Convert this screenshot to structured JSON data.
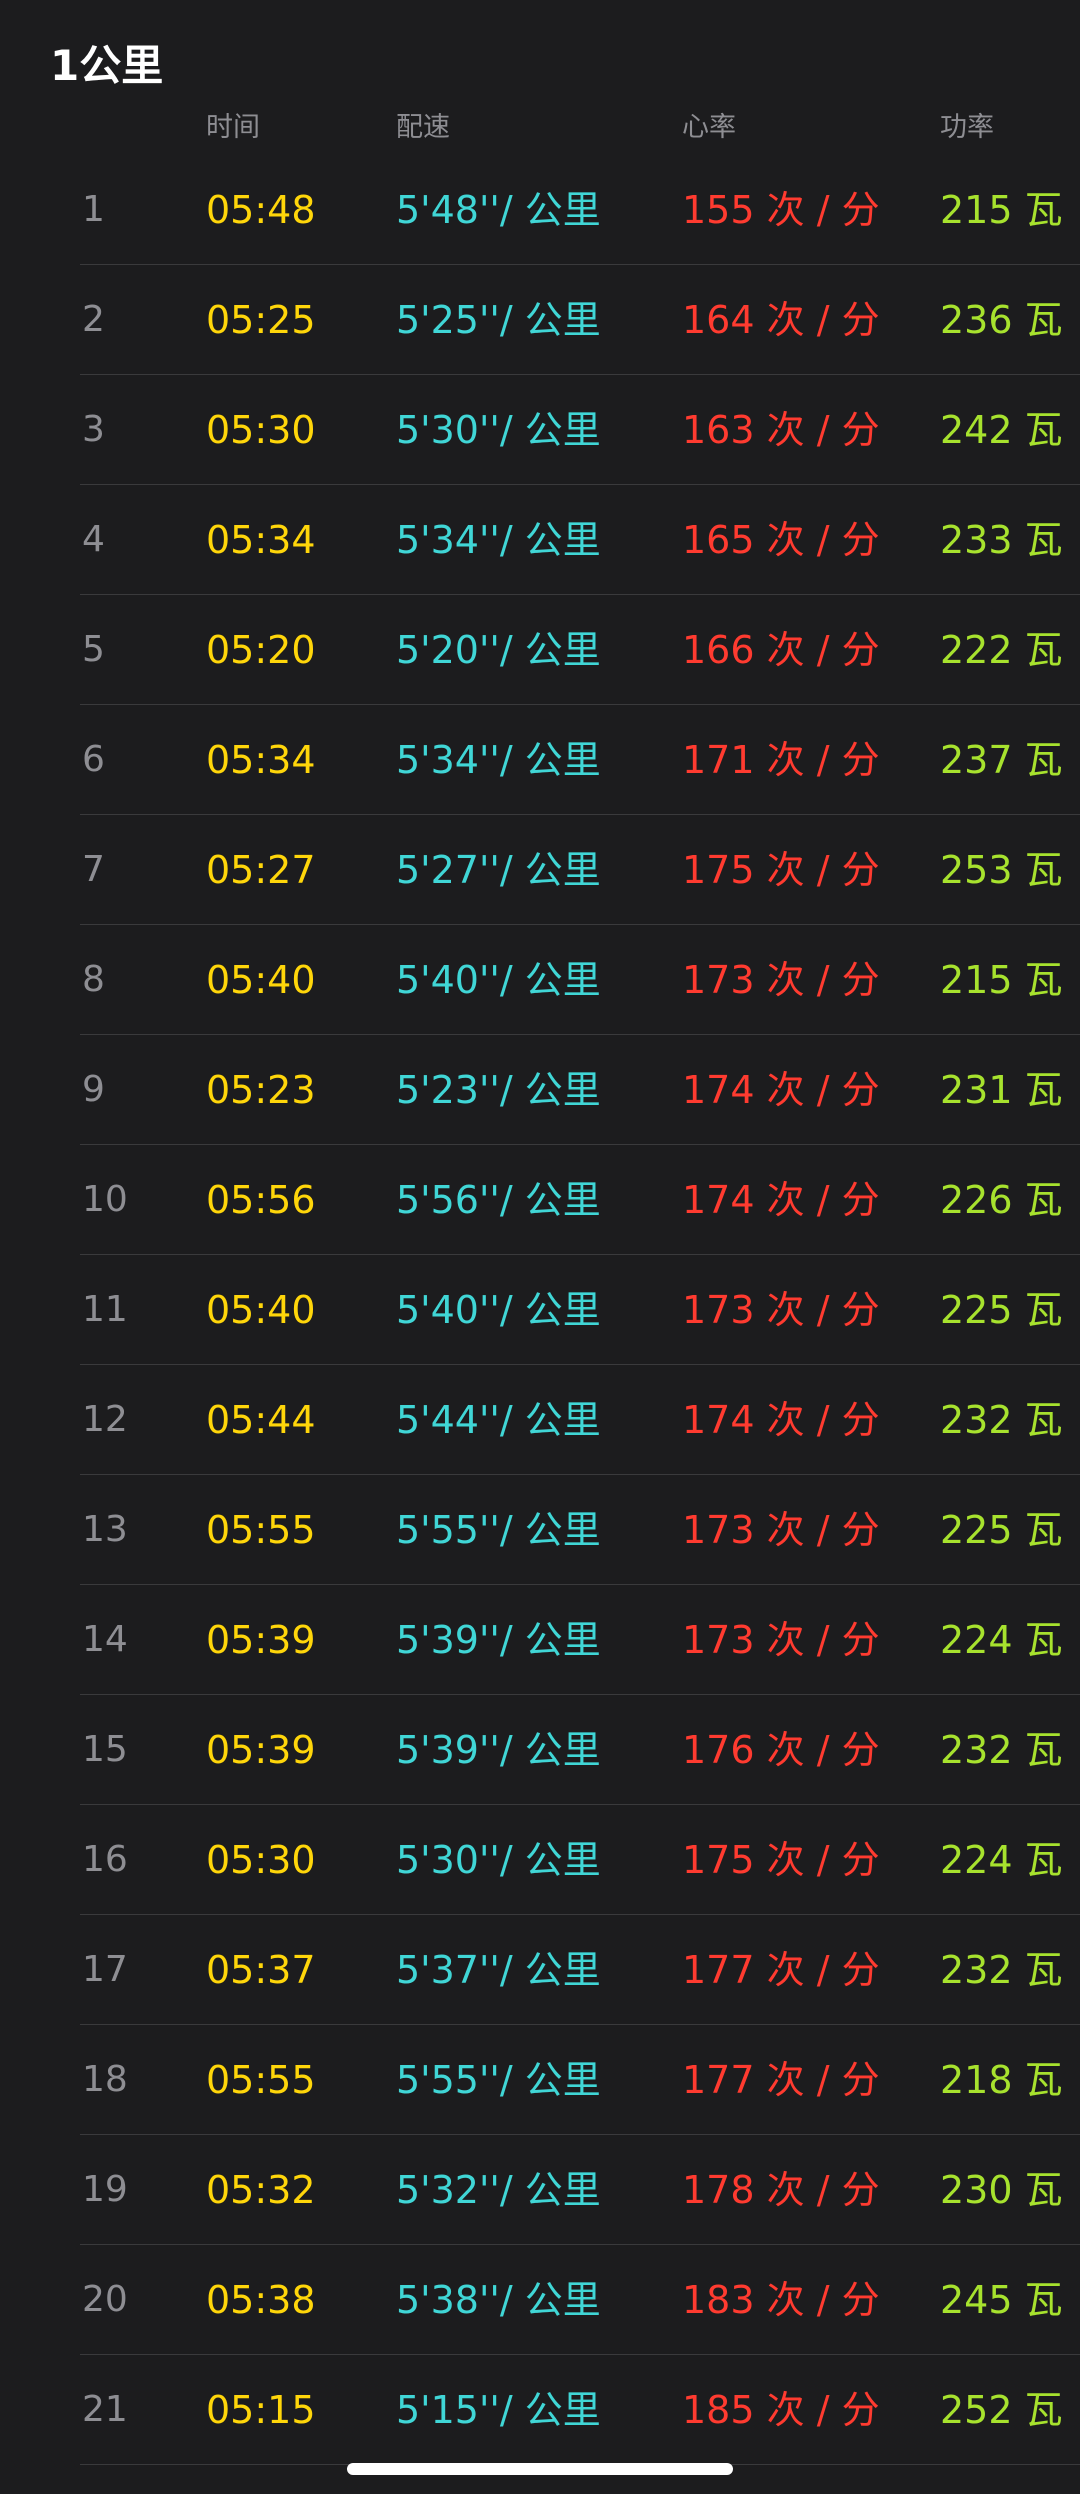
{
  "title": "1公里",
  "headers": {
    "time": "时间",
    "pace": "配速",
    "heart_rate": "心率",
    "power": "功率"
  },
  "rows": [
    {
      "index": "1",
      "time": "05:48",
      "pace": "5'48''/ 公里",
      "heart_rate": "155 次 / 分",
      "power": "215 瓦"
    },
    {
      "index": "2",
      "time": "05:25",
      "pace": "5'25''/ 公里",
      "heart_rate": "164 次 / 分",
      "power": "236 瓦"
    },
    {
      "index": "3",
      "time": "05:30",
      "pace": "5'30''/ 公里",
      "heart_rate": "163 次 / 分",
      "power": "242 瓦"
    },
    {
      "index": "4",
      "time": "05:34",
      "pace": "5'34''/ 公里",
      "heart_rate": "165 次 / 分",
      "power": "233 瓦"
    },
    {
      "index": "5",
      "time": "05:20",
      "pace": "5'20''/ 公里",
      "heart_rate": "166 次 / 分",
      "power": "222 瓦"
    },
    {
      "index": "6",
      "time": "05:34",
      "pace": "5'34''/ 公里",
      "heart_rate": "171 次 / 分",
      "power": "237 瓦"
    },
    {
      "index": "7",
      "time": "05:27",
      "pace": "5'27''/ 公里",
      "heart_rate": "175 次 / 分",
      "power": "253 瓦"
    },
    {
      "index": "8",
      "time": "05:40",
      "pace": "5'40''/ 公里",
      "heart_rate": "173 次 / 分",
      "power": "215 瓦"
    },
    {
      "index": "9",
      "time": "05:23",
      "pace": "5'23''/ 公里",
      "heart_rate": "174 次 / 分",
      "power": "231 瓦"
    },
    {
      "index": "10",
      "time": "05:56",
      "pace": "5'56''/ 公里",
      "heart_rate": "174 次 / 分",
      "power": "226 瓦"
    },
    {
      "index": "11",
      "time": "05:40",
      "pace": "5'40''/ 公里",
      "heart_rate": "173 次 / 分",
      "power": "225 瓦"
    },
    {
      "index": "12",
      "time": "05:44",
      "pace": "5'44''/ 公里",
      "heart_rate": "174 次 / 分",
      "power": "232 瓦"
    },
    {
      "index": "13",
      "time": "05:55",
      "pace": "5'55''/ 公里",
      "heart_rate": "173 次 / 分",
      "power": "225 瓦"
    },
    {
      "index": "14",
      "time": "05:39",
      "pace": "5'39''/ 公里",
      "heart_rate": "173 次 / 分",
      "power": "224 瓦"
    },
    {
      "index": "15",
      "time": "05:39",
      "pace": "5'39''/ 公里",
      "heart_rate": "176 次 / 分",
      "power": "232 瓦"
    },
    {
      "index": "16",
      "time": "05:30",
      "pace": "5'30''/ 公里",
      "heart_rate": "175 次 / 分",
      "power": "224 瓦"
    },
    {
      "index": "17",
      "time": "05:37",
      "pace": "5'37''/ 公里",
      "heart_rate": "177 次 / 分",
      "power": "232 瓦"
    },
    {
      "index": "18",
      "time": "05:55",
      "pace": "5'55''/ 公里",
      "heart_rate": "177 次 / 分",
      "power": "218 瓦"
    },
    {
      "index": "19",
      "time": "05:32",
      "pace": "5'32''/ 公里",
      "heart_rate": "178 次 / 分",
      "power": "230 瓦"
    },
    {
      "index": "20",
      "time": "05:38",
      "pace": "5'38''/ 公里",
      "heart_rate": "183 次 / 分",
      "power": "245 瓦"
    },
    {
      "index": "21",
      "time": "05:15",
      "pace": "5'15''/ 公里",
      "heart_rate": "185 次 / 分",
      "power": "252 瓦"
    }
  ],
  "colors": {
    "background": "#1c1c1e",
    "time": "#ffd60a",
    "pace": "#40d6d6",
    "heart_rate": "#ff3b30",
    "power": "#a7e22e",
    "muted": "#8e8e93"
  }
}
